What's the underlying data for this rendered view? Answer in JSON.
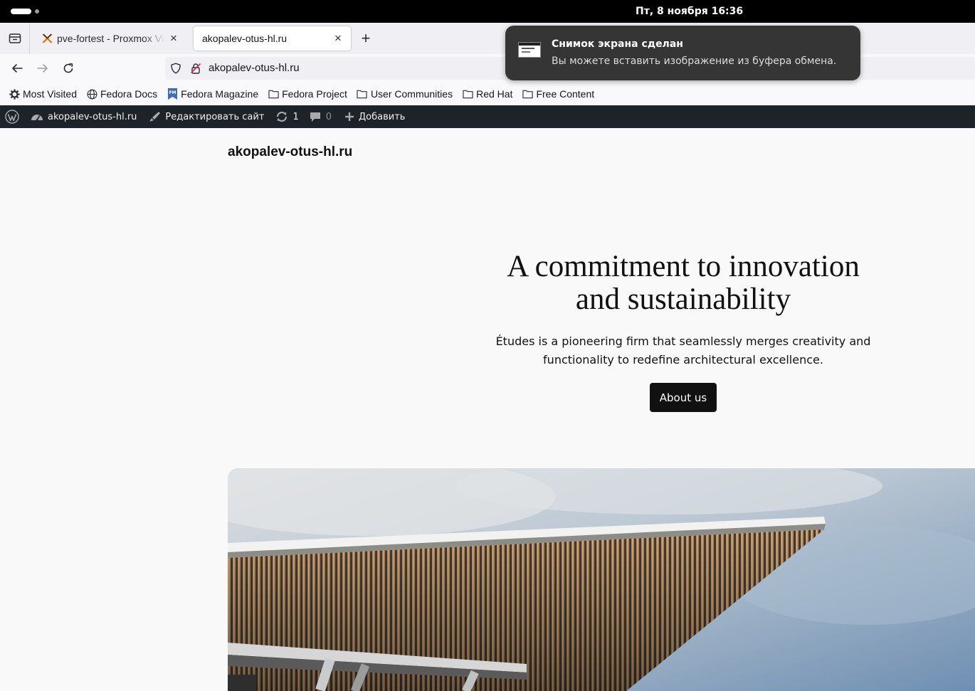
{
  "system": {
    "clock": "Пт, 8 ноября  16:36"
  },
  "tabs": [
    {
      "label": "pve-fortest - Proxmox Virtual Environment",
      "close": "×"
    },
    {
      "label": "akopalev-otus-hl.ru",
      "close": "×"
    }
  ],
  "newtab_label": "+",
  "urlbar": {
    "value": "akopalev-otus-hl.ru"
  },
  "bookmarks": [
    {
      "label": "Most Visited",
      "icon": "gear-icon"
    },
    {
      "label": "Fedora Docs",
      "icon": "globe-icon"
    },
    {
      "label": "Fedora Magazine",
      "icon": "fedora-magazine-icon"
    },
    {
      "label": "Fedora Project",
      "icon": "folder-icon"
    },
    {
      "label": "User Communities",
      "icon": "folder-icon"
    },
    {
      "label": "Red Hat",
      "icon": "folder-icon"
    },
    {
      "label": "Free Content",
      "icon": "folder-icon"
    }
  ],
  "wpbar": {
    "site_name": "akopalev-otus-hl.ru",
    "edit_site": "Редактировать сайт",
    "updates_count": "1",
    "comments_count": "0",
    "add_new": "Добавить"
  },
  "site": {
    "title": "akopalev-otus-hl.ru",
    "hero_heading": "A commitment to innovation and sustainability",
    "hero_text": "Études is a pioneering firm that seamlessly merges creativity and functionality to redefine architectural excellence.",
    "button_label": "About us"
  },
  "notification": {
    "title": "Снимок экрана сделан",
    "body": "Вы можете вставить изображение из буфера обмена."
  }
}
